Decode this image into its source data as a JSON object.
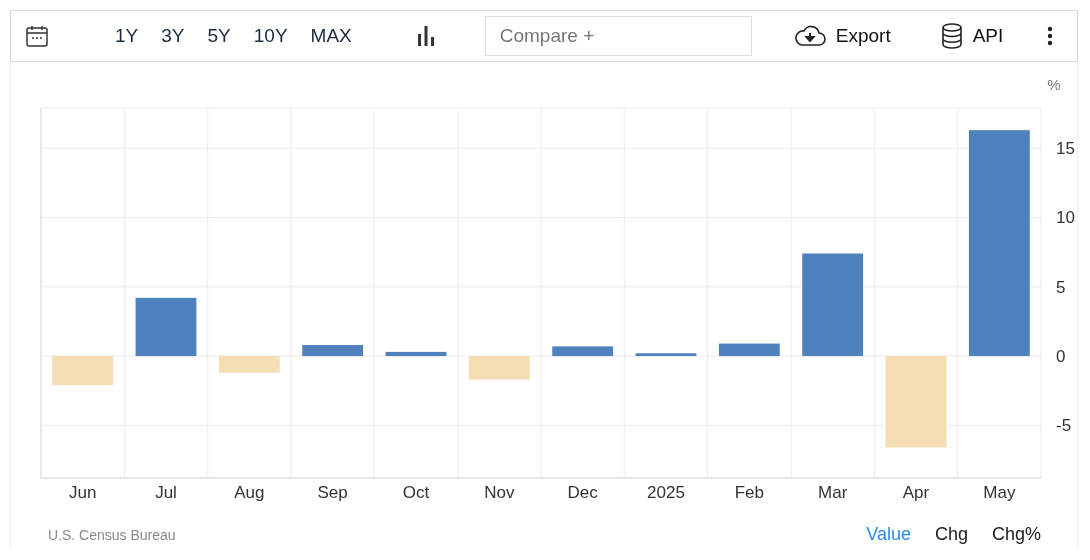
{
  "toolbar": {
    "ranges": [
      "1Y",
      "3Y",
      "5Y",
      "10Y",
      "MAX"
    ],
    "compare": {
      "placeholder": "Compare +"
    },
    "export": "Export",
    "api": "API"
  },
  "chart": {
    "chart_data": {
      "type": "bar",
      "ylabel": "%",
      "categories": [
        "Jun",
        "Jul",
        "Aug",
        "Sep",
        "Oct",
        "Nov",
        "Dec",
        "2025",
        "Feb",
        "Mar",
        "Apr",
        "May"
      ],
      "ylim": [
        -8.8,
        17.9
      ],
      "yticks": [
        -5,
        0,
        5,
        10,
        15
      ],
      "grid": true,
      "stacked": true,
      "series": [
        {
          "color": "#4f81bd",
          "values": [
            null,
            4.2,
            null,
            0.8,
            0.3,
            null,
            0.7,
            0.2,
            0.9,
            7.4,
            null,
            16.3
          ]
        },
        {
          "color": "#f5deb3",
          "values": [
            -2.1,
            null,
            -1.2,
            null,
            null,
            -1.7,
            null,
            null,
            null,
            null,
            -6.6,
            null
          ]
        }
      ]
    }
  },
  "footer": {
    "source": "U.S. Census Bureau",
    "views": [
      {
        "label": "Value",
        "selected": true
      },
      {
        "label": "Chg",
        "selected": false
      },
      {
        "label": "Chg%",
        "selected": false
      }
    ]
  }
}
